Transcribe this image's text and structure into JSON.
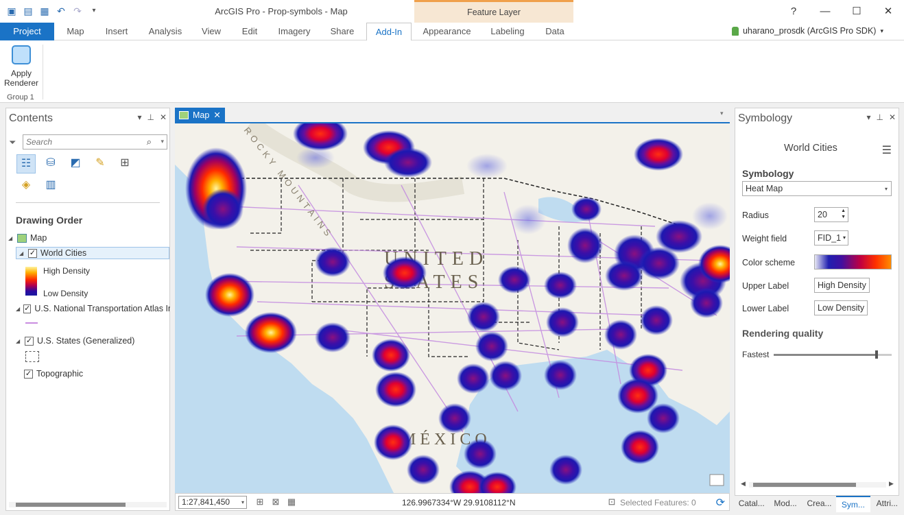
{
  "app": {
    "title": "ArcGIS Pro - Prop-symbols - Map"
  },
  "quick_access": {
    "icons": [
      "new-project-icon",
      "open-project-icon",
      "save-project-icon",
      "undo-icon",
      "redo-icon",
      "customize-icon"
    ]
  },
  "window_controls": [
    "?",
    "—",
    "☐",
    "✕"
  ],
  "context_tab": {
    "title": "Feature Layer"
  },
  "tabs": [
    "Project",
    "Map",
    "Insert",
    "Analysis",
    "View",
    "Edit",
    "Imagery",
    "Share",
    "Add-In",
    "Appearance",
    "Labeling",
    "Data"
  ],
  "active_tab": "Add-In",
  "user": {
    "name": "uharano_prosdk (ArcGIS Pro SDK)"
  },
  "ribbon": {
    "apply_renderer": "Apply\nRenderer",
    "group": "Group 1"
  },
  "contents": {
    "title": "Contents",
    "search_placeholder": "Search",
    "drawing_order": "Drawing Order",
    "map": "Map",
    "layers": [
      {
        "name": "World Cities",
        "checked": true,
        "selected": true
      },
      {
        "name": "U.S. National Transportation Atlas Int",
        "checked": true
      },
      {
        "name": "U.S. States (Generalized)",
        "checked": true
      },
      {
        "name": "Topographic",
        "checked": true
      }
    ],
    "legend": {
      "high": "High Density",
      "low": "Low Density"
    }
  },
  "map_view": {
    "tab": "Map",
    "labels": {
      "country1a": "UNITED",
      "country1b": "STATES",
      "country2": "MÉXICO",
      "mountains": "ROCKY MOUNTAINS"
    },
    "scale": "1:27,841,450",
    "coordinates": "126.9967334°W 29.9108112°N",
    "selected_features": "Selected Features: 0"
  },
  "symbology": {
    "pane_title": "Symbology",
    "layer": "World Cities",
    "section": "Symbology",
    "renderer": "Heat Map",
    "fields": {
      "radius_label": "Radius",
      "radius": "20",
      "weight_label": "Weight field",
      "weight": "FID_1",
      "color_label": "Color scheme",
      "upper_label": "Upper Label",
      "upper": "High Density",
      "lower_label": "Lower Label",
      "lower": "Low Density"
    },
    "rendering_quality": "Rendering quality",
    "quality_low": "Fastest",
    "quality_value": 0.87
  },
  "bottom_tabs": [
    "Catal...",
    "Mod...",
    "Crea...",
    "Sym...",
    "Attri..."
  ],
  "active_bottom_tab": "Sym..."
}
